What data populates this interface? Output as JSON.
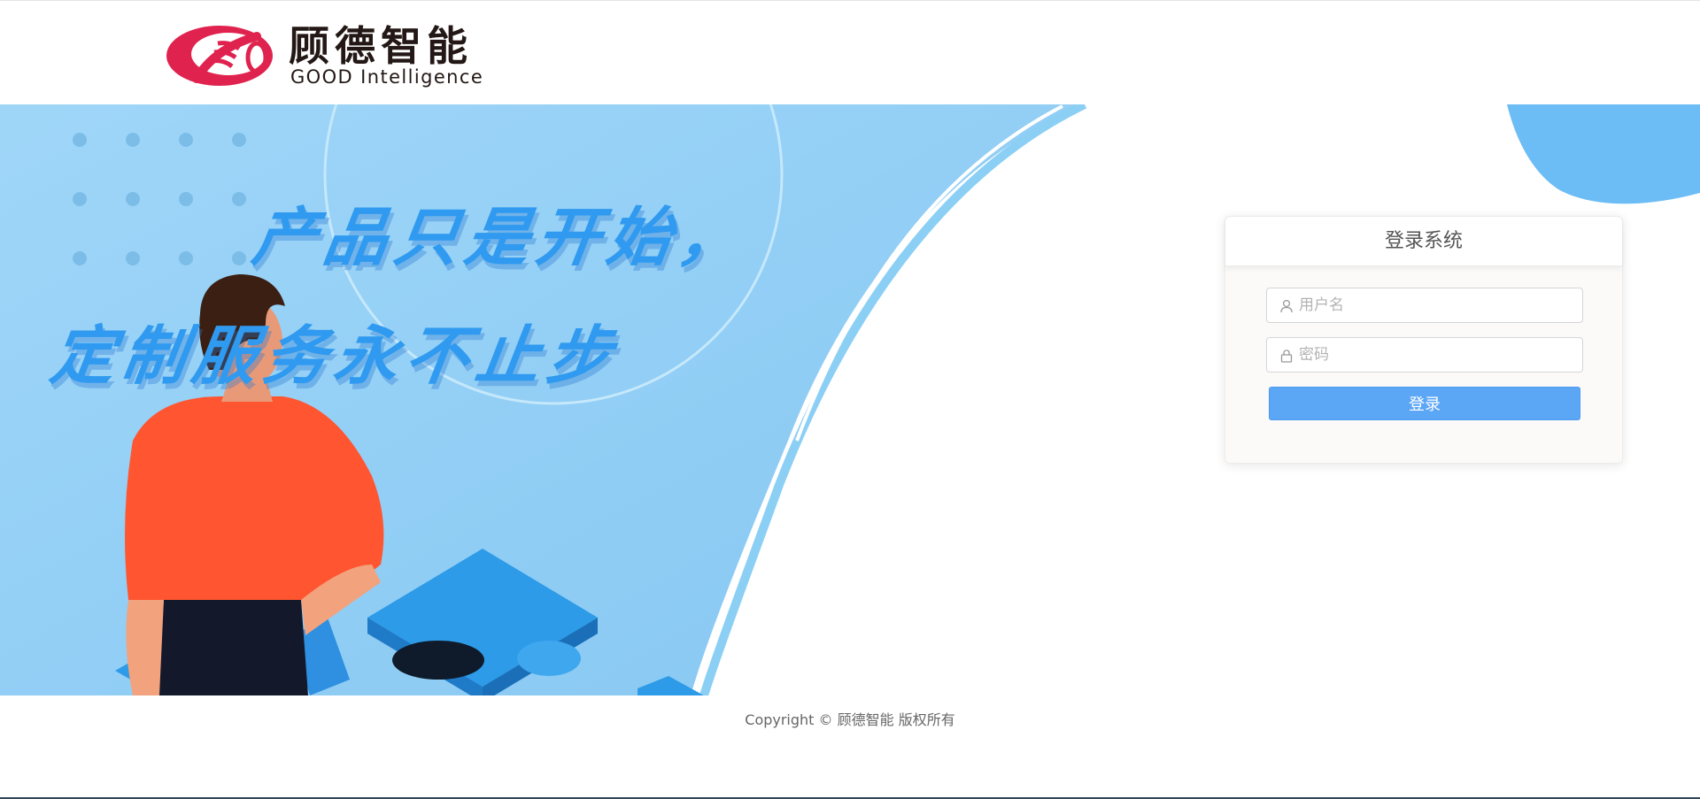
{
  "header": {
    "logo_cn": "顾德智能",
    "logo_en": "GOOD Intelligence"
  },
  "banner": {
    "slogan_line1": "产品只是开始，",
    "slogan_line2": "定制服务永不止步"
  },
  "login": {
    "title": "登录系统",
    "username_placeholder": "用户名",
    "username_value": "",
    "password_placeholder": "密码",
    "password_value": "",
    "submit_label": "登录"
  },
  "footer": {
    "copyright": "Copyright © 顾德智能 版权所有"
  },
  "colors": {
    "brand_red": "#e0234e",
    "banner_blue": "#8fcdf5",
    "accent_blue": "#5ba6f5",
    "figure_shirt": "#ff5530"
  },
  "icons": {
    "username": "user-icon",
    "password": "lock-icon"
  }
}
